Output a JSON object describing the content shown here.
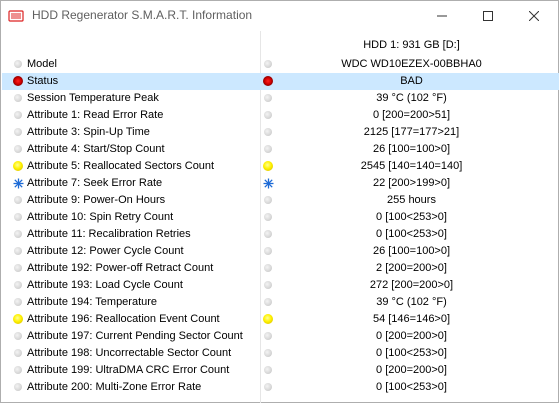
{
  "window": {
    "title": "HDD Regenerator S.M.A.R.T. Information"
  },
  "header": {
    "drive_label": "HDD 1: 931 GB [D:]"
  },
  "colors": {
    "selected_row": "#cce8ff",
    "status_bad": "#d00000",
    "status_warn": "#fff200",
    "status_info": "#1e6bd6",
    "status_ok": "#d9d9d9"
  },
  "rows": [
    {
      "name": "Model",
      "value": "WDC WD10EZEX-00BBHA0",
      "indicator": "gray"
    },
    {
      "name": "Status",
      "value": "BAD",
      "indicator": "red",
      "selected": true
    },
    {
      "name": "Session Temperature Peak",
      "value": "39 °C (102 °F)",
      "indicator": "gray"
    },
    {
      "name": "Attribute 1: Read Error Rate",
      "value": "0  [200=200>51]",
      "indicator": "gray"
    },
    {
      "name": "Attribute 3: Spin-Up Time",
      "value": "2125  [177=177>21]",
      "indicator": "gray"
    },
    {
      "name": "Attribute 4: Start/Stop Count",
      "value": "26  [100=100>0]",
      "indicator": "gray"
    },
    {
      "name": "Attribute 5: Reallocated Sectors Count",
      "value": "2545  [140=140=140]",
      "indicator": "yellow"
    },
    {
      "name": "Attribute 7: Seek Error Rate",
      "value": "22  [200>199>0]",
      "indicator": "star"
    },
    {
      "name": "Attribute 9: Power-On Hours",
      "value": "255 hours",
      "indicator": "gray"
    },
    {
      "name": "Attribute 10: Spin Retry Count",
      "value": "0  [100<253>0]",
      "indicator": "gray"
    },
    {
      "name": "Attribute 11: Recalibration Retries",
      "value": "0  [100<253>0]",
      "indicator": "gray"
    },
    {
      "name": "Attribute 12: Power Cycle Count",
      "value": "26  [100=100>0]",
      "indicator": "gray"
    },
    {
      "name": "Attribute 192: Power-off Retract Count",
      "value": "2  [200=200>0]",
      "indicator": "gray"
    },
    {
      "name": "Attribute 193: Load Cycle Count",
      "value": "272  [200=200>0]",
      "indicator": "gray"
    },
    {
      "name": "Attribute 194: Temperature",
      "value": "39 °C (102 °F)",
      "indicator": "gray"
    },
    {
      "name": "Attribute 196: Reallocation Event Count",
      "value": "54  [146=146>0]",
      "indicator": "yellow"
    },
    {
      "name": "Attribute 197: Current Pending Sector Count",
      "value": "0  [200=200>0]",
      "indicator": "gray"
    },
    {
      "name": "Attribute 198: Uncorrectable Sector Count",
      "value": "0  [100<253>0]",
      "indicator": "gray"
    },
    {
      "name": "Attribute 199: UltraDMA CRC Error Count",
      "value": "0  [200=200>0]",
      "indicator": "gray"
    },
    {
      "name": "Attribute 200: Multi-Zone Error Rate",
      "value": "0  [100<253>0]",
      "indicator": "gray"
    }
  ]
}
